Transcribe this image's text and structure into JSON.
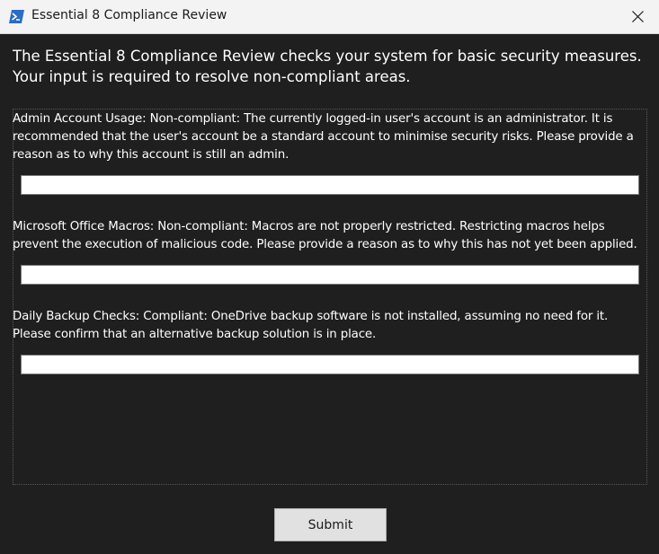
{
  "window": {
    "title": "Essential 8 Compliance Review",
    "icon": "powershell-icon",
    "close_icon": "close-icon"
  },
  "intro": "The Essential 8 Compliance Review checks your system for basic security measures. Your input is required to resolve non-compliant areas.",
  "questions": [
    {
      "label": "Admin Account Usage: Non-compliant: The currently logged-in user's account is an administrator. It is recommended that the user's account be a standard account to minimise security risks. Please provide a reason as to why this account is still an admin.",
      "value": ""
    },
    {
      "label": "Microsoft Office Macros: Non-compliant: Macros are not properly restricted. Restricting macros helps prevent the execution of malicious code. Please provide a reason as to why this has not yet been applied.",
      "value": ""
    },
    {
      "label": "Daily Backup Checks: Compliant: OneDrive backup software is not installed, assuming no need for it. Please confirm that an alternative backup solution is in place.",
      "value": ""
    }
  ],
  "submit_label": "Submit",
  "colors": {
    "background": "#1f1f1f",
    "titlebar": "#f3f3f3",
    "text": "#ffffff",
    "button": "#e1e1e1",
    "powershell_blue": "#2b6cc4"
  }
}
